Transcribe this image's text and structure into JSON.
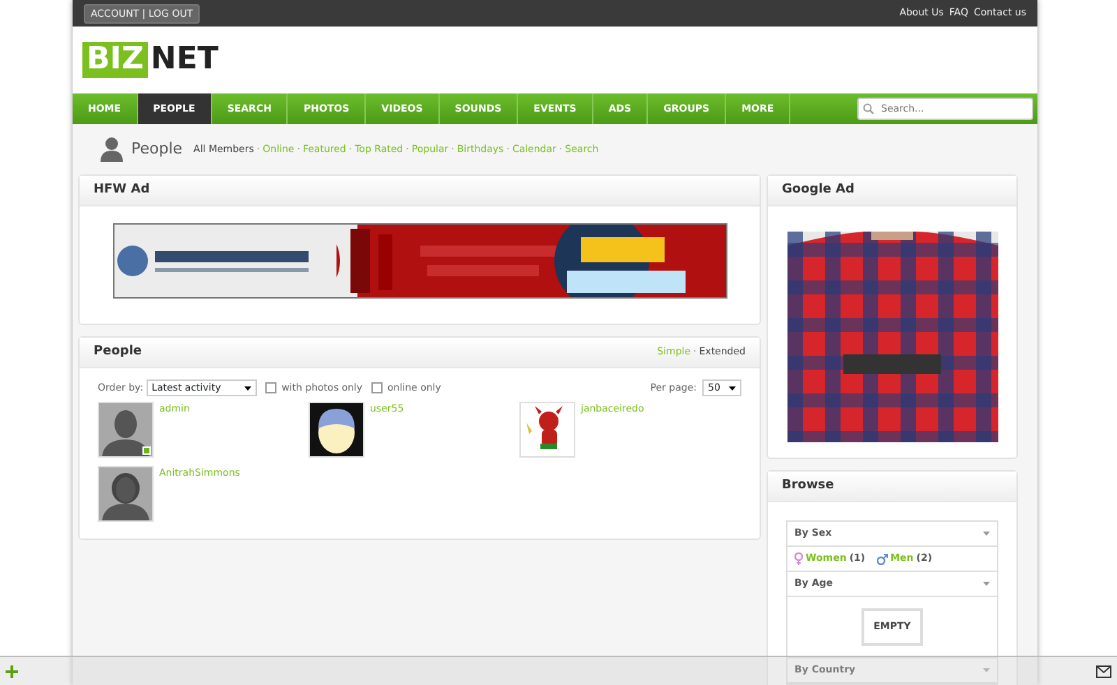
{
  "topbar": {
    "account": "ACCOUNT | LOG OUT",
    "links": [
      "About Us",
      "FAQ",
      "Contact us"
    ]
  },
  "logo": {
    "left": "BIZ",
    "right": "NET"
  },
  "nav": {
    "items": [
      {
        "label": "HOME",
        "selected": false
      },
      {
        "label": "PEOPLE",
        "selected": true
      },
      {
        "label": "SEARCH",
        "selected": false
      },
      {
        "label": "PHOTOS",
        "selected": false
      },
      {
        "label": "VIDEOS",
        "selected": false
      },
      {
        "label": "SOUNDS",
        "selected": false
      },
      {
        "label": "EVENTS",
        "selected": false
      },
      {
        "label": "ADS",
        "selected": false
      },
      {
        "label": "GROUPS",
        "selected": false
      },
      {
        "label": "MORE",
        "selected": false
      }
    ],
    "search_placeholder": "Search..."
  },
  "subnav": {
    "title": "People",
    "separator": "·",
    "links": [
      {
        "label": "All Members",
        "selected": true
      },
      {
        "label": "Online",
        "selected": false
      },
      {
        "label": "Featured",
        "selected": false
      },
      {
        "label": "Top Rated",
        "selected": false
      },
      {
        "label": "Popular",
        "selected": false
      },
      {
        "label": "Birthdays",
        "selected": false
      },
      {
        "label": "Calendar",
        "selected": false
      },
      {
        "label": "Search",
        "selected": false
      }
    ]
  },
  "hfw_ad": {
    "title": "HFW Ad"
  },
  "people": {
    "title": "People",
    "views": [
      {
        "label": "Simple",
        "selected": false
      },
      {
        "label": "Extended",
        "selected": true
      }
    ],
    "separator": "·",
    "order_label": "Order by:",
    "order_value": "Latest activity",
    "filters": [
      {
        "label": "with photos only",
        "checked": false
      },
      {
        "label": "online only",
        "checked": false
      }
    ],
    "per_page_label": "Per page:",
    "per_page_value": "50",
    "members": [
      {
        "name": "admin",
        "kind": "silhouette",
        "online": true
      },
      {
        "name": "user55",
        "kind": "cartoon",
        "online": false
      },
      {
        "name": "janbaceiredo",
        "kind": "character",
        "online": false
      },
      {
        "name": "AnitrahSimmons",
        "kind": "longhair",
        "online": false
      }
    ]
  },
  "google_ad": {
    "title": "Google Ad"
  },
  "browse": {
    "title": "Browse",
    "sections": [
      {
        "title": "By Sex",
        "kind": "links",
        "items": [
          {
            "label": "Women",
            "count": "(1)",
            "kind": "female"
          },
          {
            "label": "Men",
            "count": "(2)",
            "kind": "male"
          }
        ]
      },
      {
        "title": "By Age",
        "kind": "empty",
        "empty_label": "EMPTY"
      },
      {
        "title": "By Country",
        "kind": "collapsed"
      }
    ]
  }
}
